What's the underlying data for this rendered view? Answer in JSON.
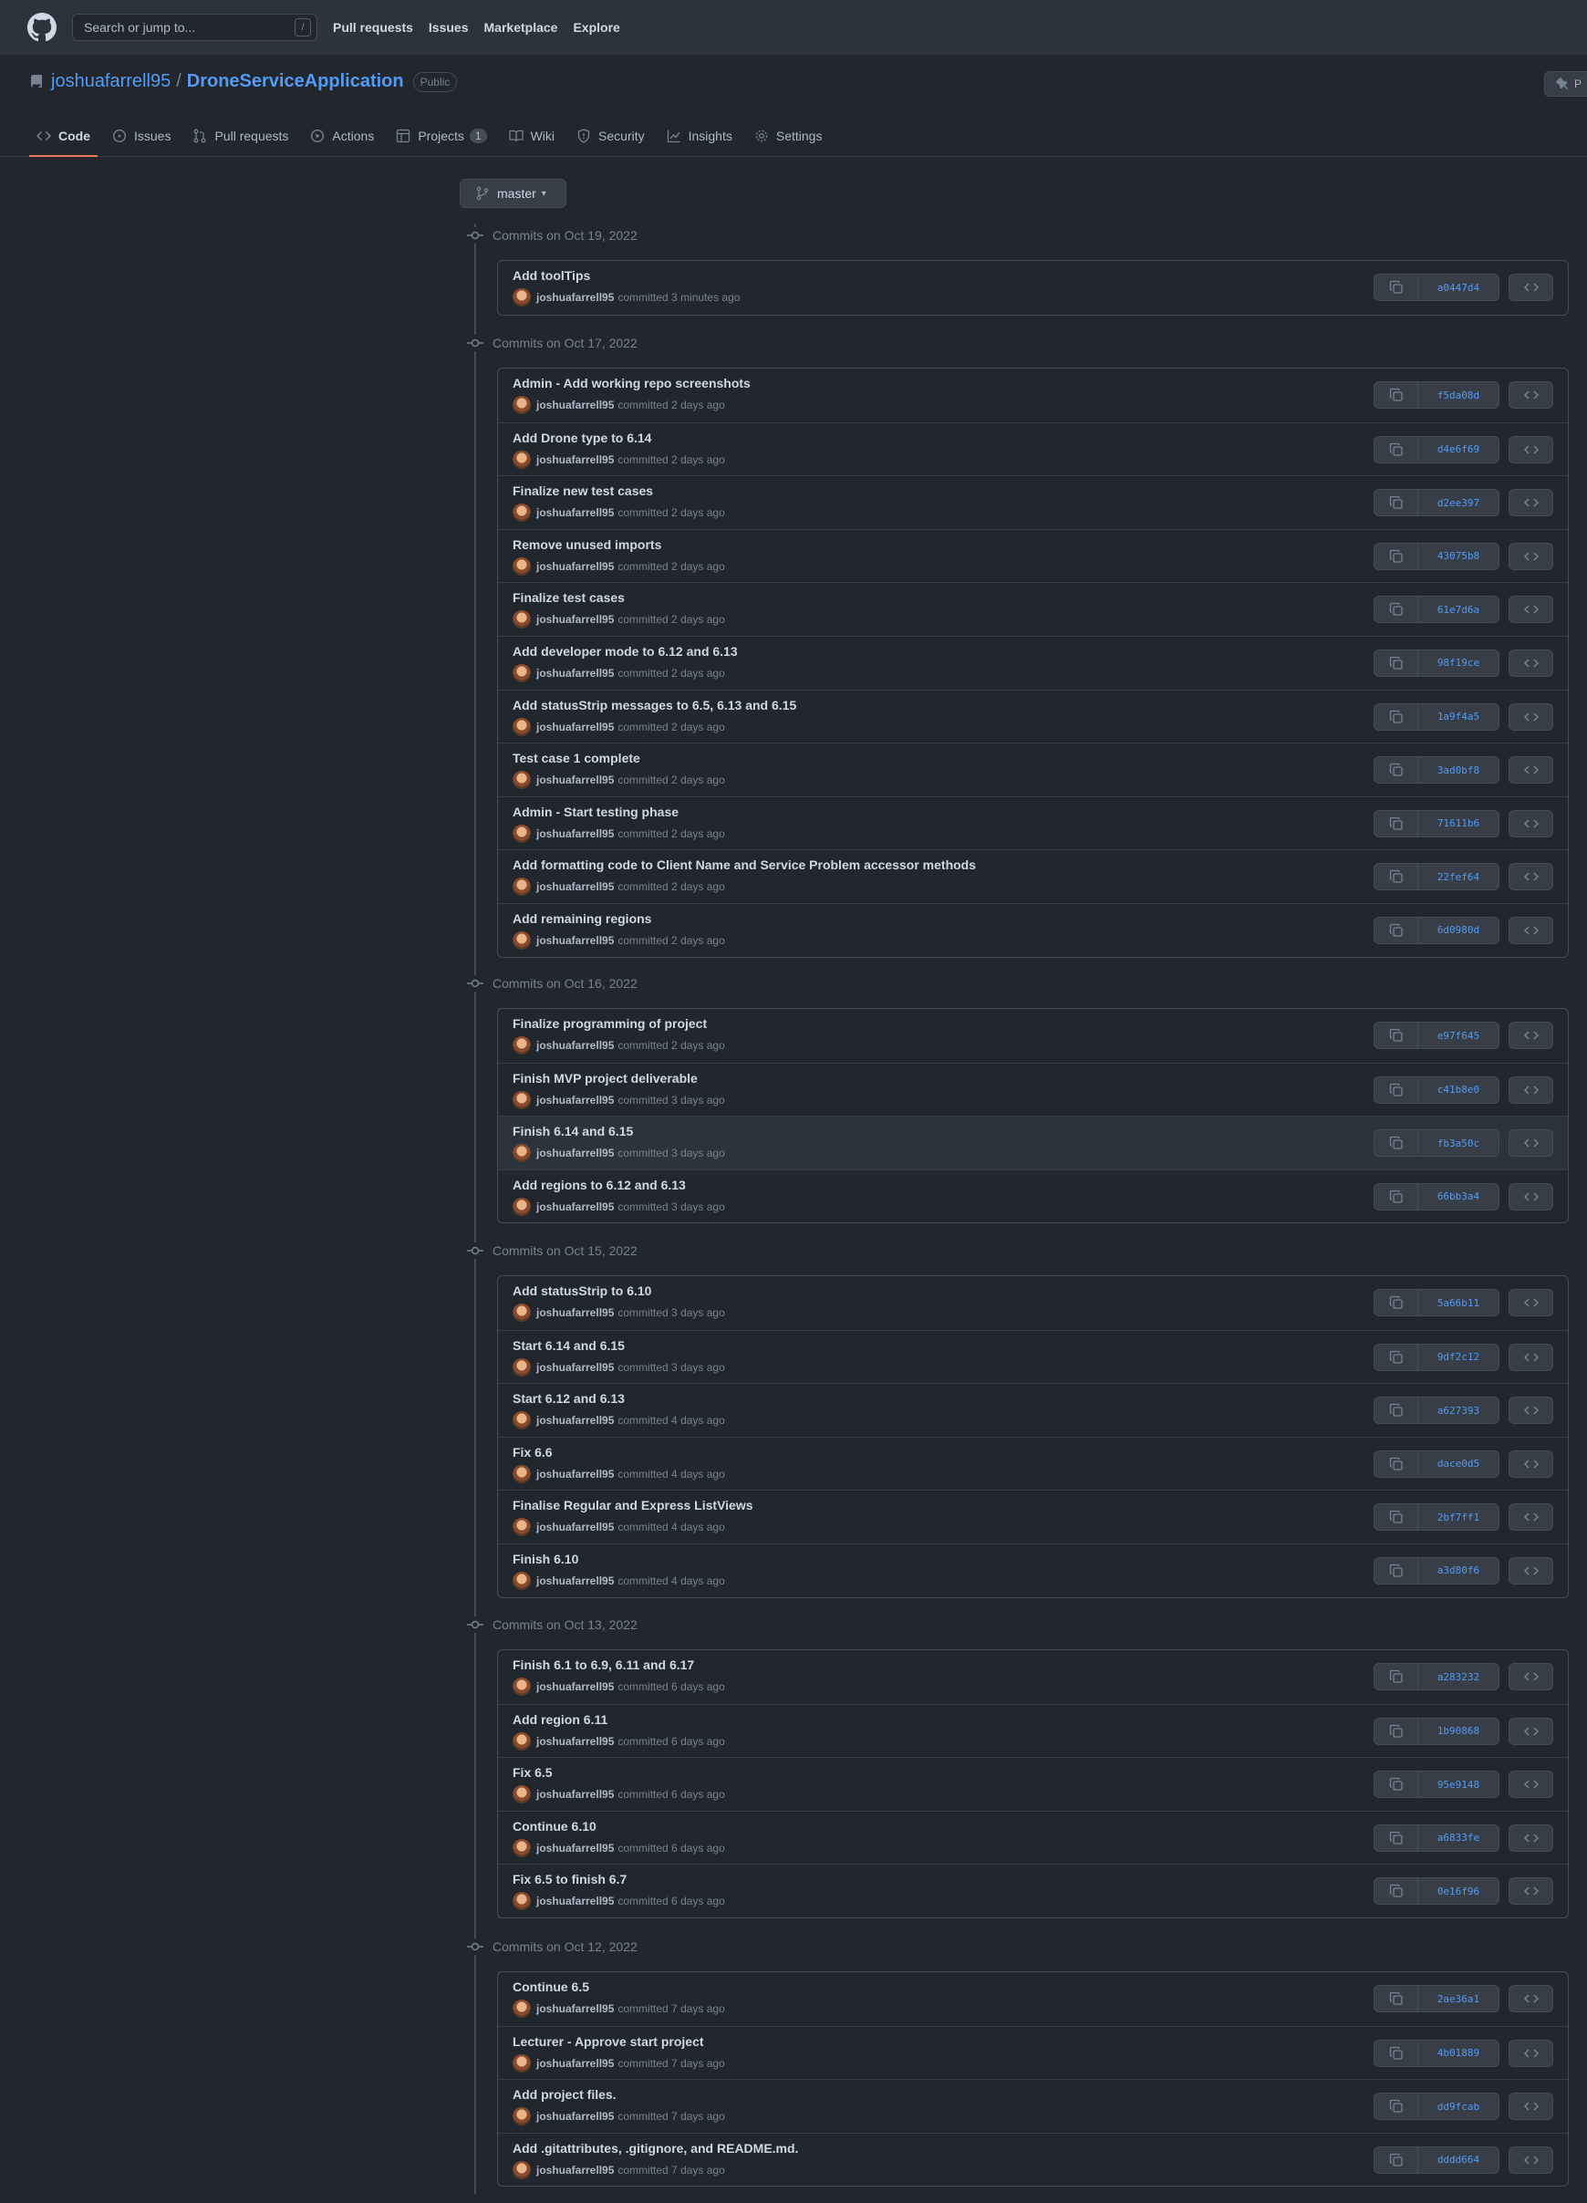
{
  "header": {
    "search_placeholder": "Search or jump to...",
    "search_key": "/",
    "nav": [
      "Pull requests",
      "Issues",
      "Marketplace",
      "Explore"
    ]
  },
  "repo": {
    "owner": "joshuafarrell95",
    "separator": "/",
    "name": "DroneServiceApplication",
    "visibility": "Public",
    "pin_label": "P"
  },
  "tabs": [
    {
      "label": "Code",
      "icon": "code-icon"
    },
    {
      "label": "Issues",
      "icon": "issue-icon"
    },
    {
      "label": "Pull requests",
      "icon": "pull-request-icon"
    },
    {
      "label": "Actions",
      "icon": "play-icon"
    },
    {
      "label": "Projects",
      "icon": "table-icon",
      "count": "1"
    },
    {
      "label": "Wiki",
      "icon": "book-icon"
    },
    {
      "label": "Security",
      "icon": "shield-icon"
    },
    {
      "label": "Insights",
      "icon": "graph-icon"
    },
    {
      "label": "Settings",
      "icon": "gear-icon"
    }
  ],
  "branch": "master",
  "groups": [
    {
      "date": "Commits on Oct 19, 2022",
      "commits": [
        {
          "title": "Add toolTips",
          "author": "joshuafarrell95",
          "time": "committed 3 minutes ago",
          "sha": "a0447d4"
        }
      ]
    },
    {
      "date": "Commits on Oct 17, 2022",
      "commits": [
        {
          "title": "Admin - Add working repo screenshots",
          "author": "joshuafarrell95",
          "time": "committed 2 days ago",
          "sha": "f5da08d"
        },
        {
          "title": "Add Drone type to 6.14",
          "author": "joshuafarrell95",
          "time": "committed 2 days ago",
          "sha": "d4e6f69"
        },
        {
          "title": "Finalize new test cases",
          "author": "joshuafarrell95",
          "time": "committed 2 days ago",
          "sha": "d2ee397"
        },
        {
          "title": "Remove unused imports",
          "author": "joshuafarrell95",
          "time": "committed 2 days ago",
          "sha": "43075b8"
        },
        {
          "title": "Finalize test cases",
          "author": "joshuafarrell95",
          "time": "committed 2 days ago",
          "sha": "61e7d6a"
        },
        {
          "title": "Add developer mode to 6.12 and 6.13",
          "author": "joshuafarrell95",
          "time": "committed 2 days ago",
          "sha": "98f19ce"
        },
        {
          "title": "Add statusStrip messages to 6.5, 6.13 and 6.15",
          "author": "joshuafarrell95",
          "time": "committed 2 days ago",
          "sha": "1a9f4a5"
        },
        {
          "title": "Test case 1 complete",
          "author": "joshuafarrell95",
          "time": "committed 2 days ago",
          "sha": "3ad0bf8"
        },
        {
          "title": "Admin - Start testing phase",
          "author": "joshuafarrell95",
          "time": "committed 2 days ago",
          "sha": "71611b6"
        },
        {
          "title": "Add formatting code to Client Name and Service Problem accessor methods",
          "author": "joshuafarrell95",
          "time": "committed 2 days ago",
          "sha": "22fef64"
        },
        {
          "title": "Add remaining regions",
          "author": "joshuafarrell95",
          "time": "committed 2 days ago",
          "sha": "6d0980d"
        }
      ]
    },
    {
      "date": "Commits on Oct 16, 2022",
      "commits": [
        {
          "title": "Finalize programming of project",
          "author": "joshuafarrell95",
          "time": "committed 2 days ago",
          "sha": "e97f645"
        },
        {
          "title": "Finish MVP project deliverable",
          "author": "joshuafarrell95",
          "time": "committed 3 days ago",
          "sha": "c41b8e0"
        },
        {
          "title": "Finish 6.14 and 6.15",
          "author": "joshuafarrell95",
          "time": "committed 3 days ago",
          "sha": "fb3a50c",
          "highlight": true
        },
        {
          "title": "Add regions to 6.12 and 6.13",
          "author": "joshuafarrell95",
          "time": "committed 3 days ago",
          "sha": "66bb3a4"
        }
      ]
    },
    {
      "date": "Commits on Oct 15, 2022",
      "commits": [
        {
          "title": "Add statusStrip to 6.10",
          "author": "joshuafarrell95",
          "time": "committed 3 days ago",
          "sha": "5a66b11"
        },
        {
          "title": "Start 6.14 and 6.15",
          "author": "joshuafarrell95",
          "time": "committed 3 days ago",
          "sha": "9df2c12"
        },
        {
          "title": "Start 6.12 and 6.13",
          "author": "joshuafarrell95",
          "time": "committed 4 days ago",
          "sha": "a627393"
        },
        {
          "title": "Fix 6.6",
          "author": "joshuafarrell95",
          "time": "committed 4 days ago",
          "sha": "dace0d5"
        },
        {
          "title": "Finalise Regular and Express ListViews",
          "author": "joshuafarrell95",
          "time": "committed 4 days ago",
          "sha": "2bf7ff1"
        },
        {
          "title": "Finish 6.10",
          "author": "joshuafarrell95",
          "time": "committed 4 days ago",
          "sha": "a3d80f6"
        }
      ]
    },
    {
      "date": "Commits on Oct 13, 2022",
      "commits": [
        {
          "title": "Finish 6.1 to 6.9, 6.11 and 6.17",
          "author": "joshuafarrell95",
          "time": "committed 6 days ago",
          "sha": "a283232"
        },
        {
          "title": "Add region 6.11",
          "author": "joshuafarrell95",
          "time": "committed 6 days ago",
          "sha": "1b90868"
        },
        {
          "title": "Fix 6.5",
          "author": "joshuafarrell95",
          "time": "committed 6 days ago",
          "sha": "95e9148"
        },
        {
          "title": "Continue 6.10",
          "author": "joshuafarrell95",
          "time": "committed 6 days ago",
          "sha": "a6833fe"
        },
        {
          "title": "Fix 6.5 to finish 6.7",
          "author": "joshuafarrell95",
          "time": "committed 6 days ago",
          "sha": "0e16f96"
        }
      ]
    },
    {
      "date": "Commits on Oct 12, 2022",
      "commits": [
        {
          "title": "Continue 6.5",
          "author": "joshuafarrell95",
          "time": "committed 7 days ago",
          "sha": "2ae36a1"
        },
        {
          "title": "Lecturer - Approve start project",
          "author": "joshuafarrell95",
          "time": "committed 7 days ago",
          "sha": "4b01889"
        },
        {
          "title": "Add project files.",
          "author": "joshuafarrell95",
          "time": "committed 7 days ago",
          "sha": "dd9fcab"
        },
        {
          "title": "Add .gitattributes, .gitignore, and README.md.",
          "author": "joshuafarrell95",
          "time": "committed 7 days ago",
          "sha": "dddd664"
        }
      ]
    }
  ]
}
